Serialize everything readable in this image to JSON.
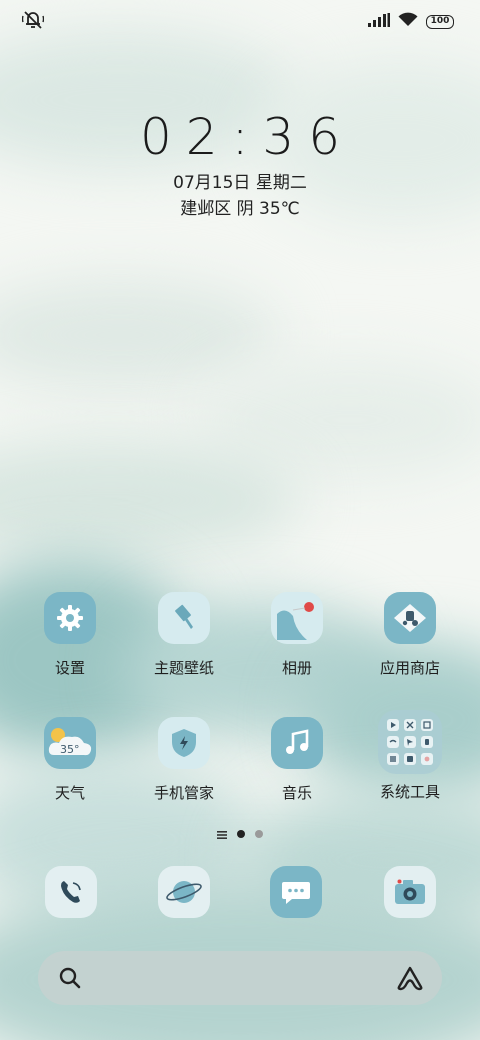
{
  "status_bar": {
    "left_icon": "bell-muted-icon",
    "signal_icon": "signal-icon",
    "wifi_icon": "wifi-icon",
    "battery": "100"
  },
  "lockclock": {
    "time": "02:36",
    "date": "07月15日 星期二",
    "weather": "建邺区 阴 35℃"
  },
  "apps": [
    {
      "label": "设置",
      "icon": "settings-icon"
    },
    {
      "label": "主题壁纸",
      "icon": "theme-brush-icon"
    },
    {
      "label": "相册",
      "icon": "gallery-icon"
    },
    {
      "label": "应用商店",
      "icon": "app-store-icon"
    },
    {
      "label": "天气",
      "icon": "weather-icon",
      "weather_icon_text": "35°"
    },
    {
      "label": "手机管家",
      "icon": "phone-manager-icon"
    },
    {
      "label": "音乐",
      "icon": "music-icon"
    },
    {
      "label": "系统工具",
      "icon": "system-tools-folder-icon"
    }
  ],
  "page_indicator": {
    "pages": 2,
    "current": 1
  },
  "dock": [
    {
      "icon": "phone-icon"
    },
    {
      "icon": "browser-planet-icon"
    },
    {
      "icon": "messages-icon"
    },
    {
      "icon": "camera-icon"
    }
  ],
  "search_bar": {
    "search_icon": "search-icon",
    "assistant_icon": "assistant-icon"
  },
  "colors": {
    "icon_bg": "#7bb6c6",
    "icon_light": "#d6ebef",
    "text": "#1f1f1f"
  }
}
